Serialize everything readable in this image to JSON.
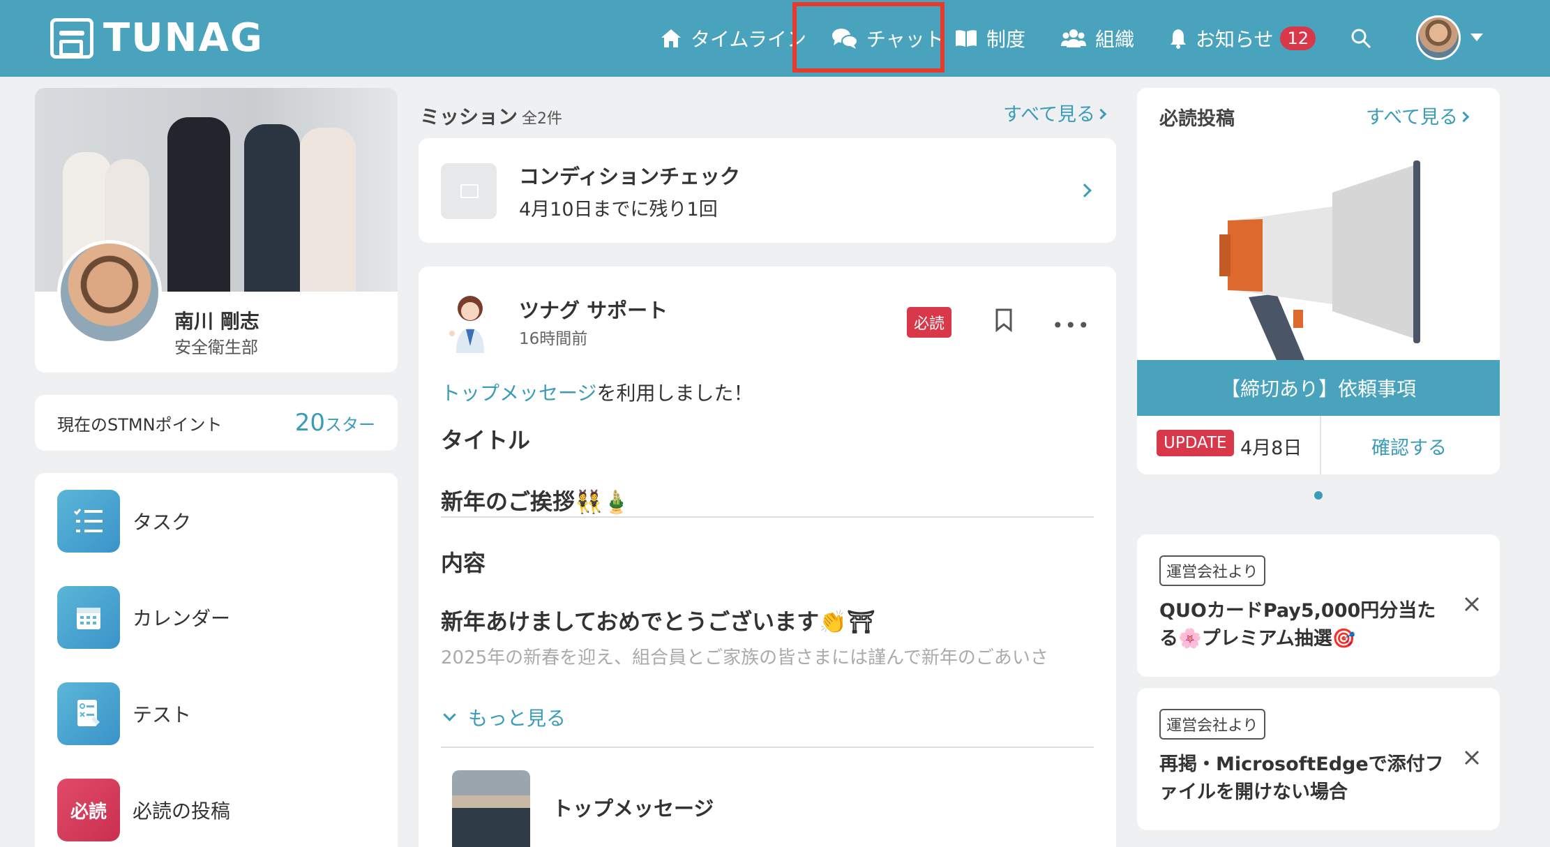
{
  "header": {
    "logo": "TUNAG",
    "nav": [
      {
        "label": "タイムライン",
        "icon": "home-icon"
      },
      {
        "label": "チャット",
        "icon": "chat-icon"
      },
      {
        "label": "制度",
        "icon": "book-icon"
      },
      {
        "label": "組織",
        "icon": "people-icon"
      },
      {
        "label": "お知らせ",
        "icon": "bell-icon",
        "badge": "12"
      }
    ]
  },
  "profile": {
    "name": "南川 剛志",
    "department": "安全衛生部"
  },
  "points": {
    "label": "現在のSTMNポイント",
    "value": "20",
    "unit": "スター"
  },
  "menu": [
    {
      "label": "タスク",
      "icon": "task-list-icon"
    },
    {
      "label": "カレンダー",
      "icon": "calendar-icon"
    },
    {
      "label": "テスト",
      "icon": "test-icon"
    },
    {
      "label": "必読の投稿",
      "icon": "must-read-icon",
      "icon_text": "必読"
    }
  ],
  "mission": {
    "title": "ミッション",
    "count": "全2件",
    "see_all": "すべて見る",
    "item": {
      "name": "コンディションチェック",
      "deadline": "4月10日までに残り1回"
    }
  },
  "post": {
    "author": "ツナグ サポート",
    "time": "16時間前",
    "badge": "必読",
    "activity_link": "トップメッセージ",
    "activity_text": "を利用しました！",
    "title_label": "タイトル",
    "title_value": "新年のご挨拶👯🎍",
    "content_label": "内容",
    "content_heading": "新年あけましておめでとうございます👏⛩",
    "content_preview": "2025年の新春を迎え、組合員とご家族の皆さまには謹んで新年のごあいさ",
    "more_label": "もっと見る",
    "attachment_title": "トップメッセージ"
  },
  "must_read": {
    "title": "必読投稿",
    "see_all": "すべて見る",
    "banner": "【締切あり】依頼事項",
    "update_badge": "UPDATE",
    "date": "4月8日",
    "confirm": "確認する"
  },
  "notices": [
    {
      "tag": "運営会社より",
      "text": "QUOカードPay5,000円分当たる🌸プレミアム抽選🎯"
    },
    {
      "tag": "運営会社より",
      "text": "再掲・MicrosoftEdgeで添付ファイルを開けない場合"
    }
  ],
  "colors": {
    "header": "#4aa3bd",
    "accent": "#3a9cb8",
    "badge_red": "#d9374a",
    "highlight": "#e53a2c"
  }
}
